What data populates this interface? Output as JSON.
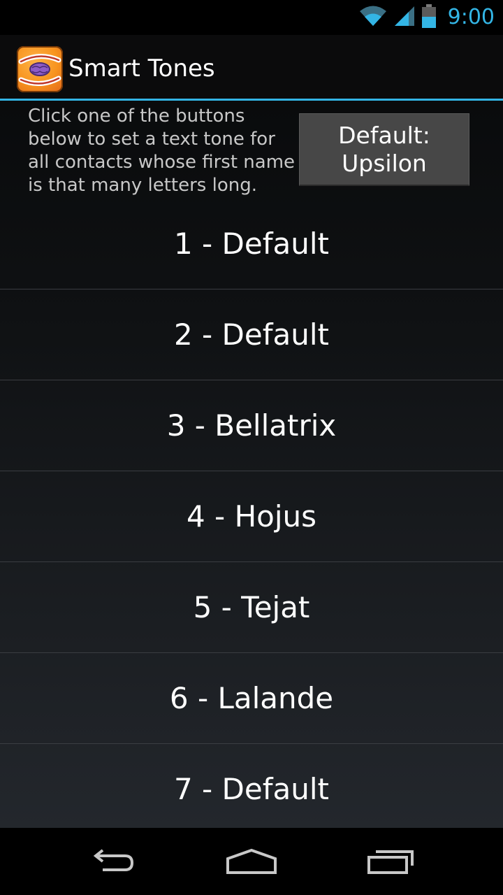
{
  "status_bar": {
    "time": "9:00",
    "icons": [
      "wifi-icon",
      "signal-icon",
      "battery-icon"
    ],
    "accent_color": "#33b5e5"
  },
  "action_bar": {
    "title": "Smart Tones",
    "app_icon": "smart-tones-app-icon"
  },
  "header": {
    "instructions": "Click one of the buttons below to set a text tone for all contacts whose first name is that many letters long.",
    "default_button_line1": "Default:",
    "default_button_line2": "Upsilon"
  },
  "tones": [
    {
      "label": "1 - Default"
    },
    {
      "label": "2 - Default"
    },
    {
      "label": "3 - Bellatrix"
    },
    {
      "label": "4 - Hojus"
    },
    {
      "label": "5 - Tejat"
    },
    {
      "label": "6 - Lalande"
    },
    {
      "label": "7 - Default"
    }
  ],
  "nav_bar": {
    "buttons": [
      "back-icon",
      "home-icon",
      "recent-apps-icon"
    ]
  }
}
